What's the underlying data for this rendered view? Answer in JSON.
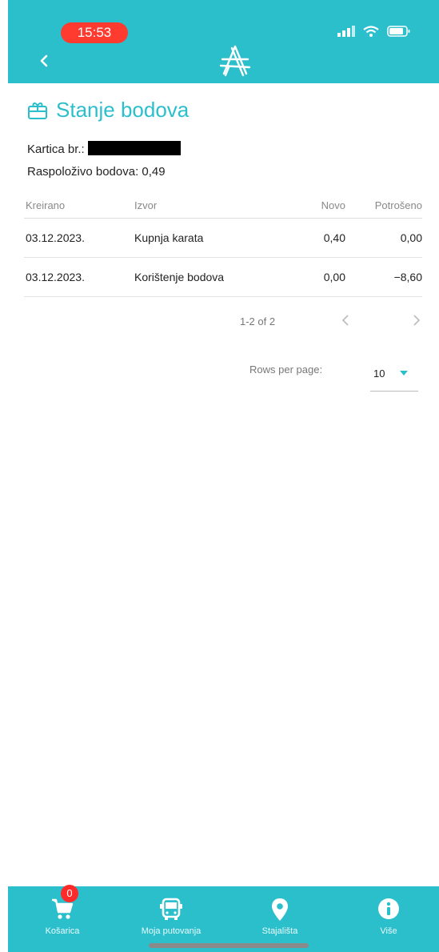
{
  "status_bar": {
    "time": "15:53"
  },
  "page": {
    "title": "Stanje bodova",
    "card_label": "Kartica br.:",
    "points_label": "Raspoloživo bodova: 0,49"
  },
  "table": {
    "headers": [
      "Kreirano",
      "Izvor",
      "Novo",
      "Potrošeno"
    ],
    "rows": [
      [
        "03.12.2023.",
        "Kupnja karata",
        "0,40",
        "0,00"
      ],
      [
        "03.12.2023.",
        "Korištenje bodova",
        "0,00",
        "−8,60"
      ]
    ]
  },
  "pagination": {
    "range": "1-2 of 2",
    "rows_per_page_label": "Rows per page:",
    "rows_per_page_value": "10"
  },
  "bottom_nav": {
    "cart_label": "Košarica",
    "cart_badge": "0",
    "trips_label": "Moja putovanja",
    "stops_label": "Stajališta",
    "more_label": "Više"
  },
  "colors": {
    "accent": "#2bbfcc",
    "badge": "#ff2a2a"
  },
  "icons": {
    "back": "chevron-left-icon",
    "logo": "app-logo",
    "title": "gift-icon",
    "cart": "cart-icon",
    "trips": "bus-icon",
    "stops": "location-pin-icon",
    "more": "info-icon"
  }
}
